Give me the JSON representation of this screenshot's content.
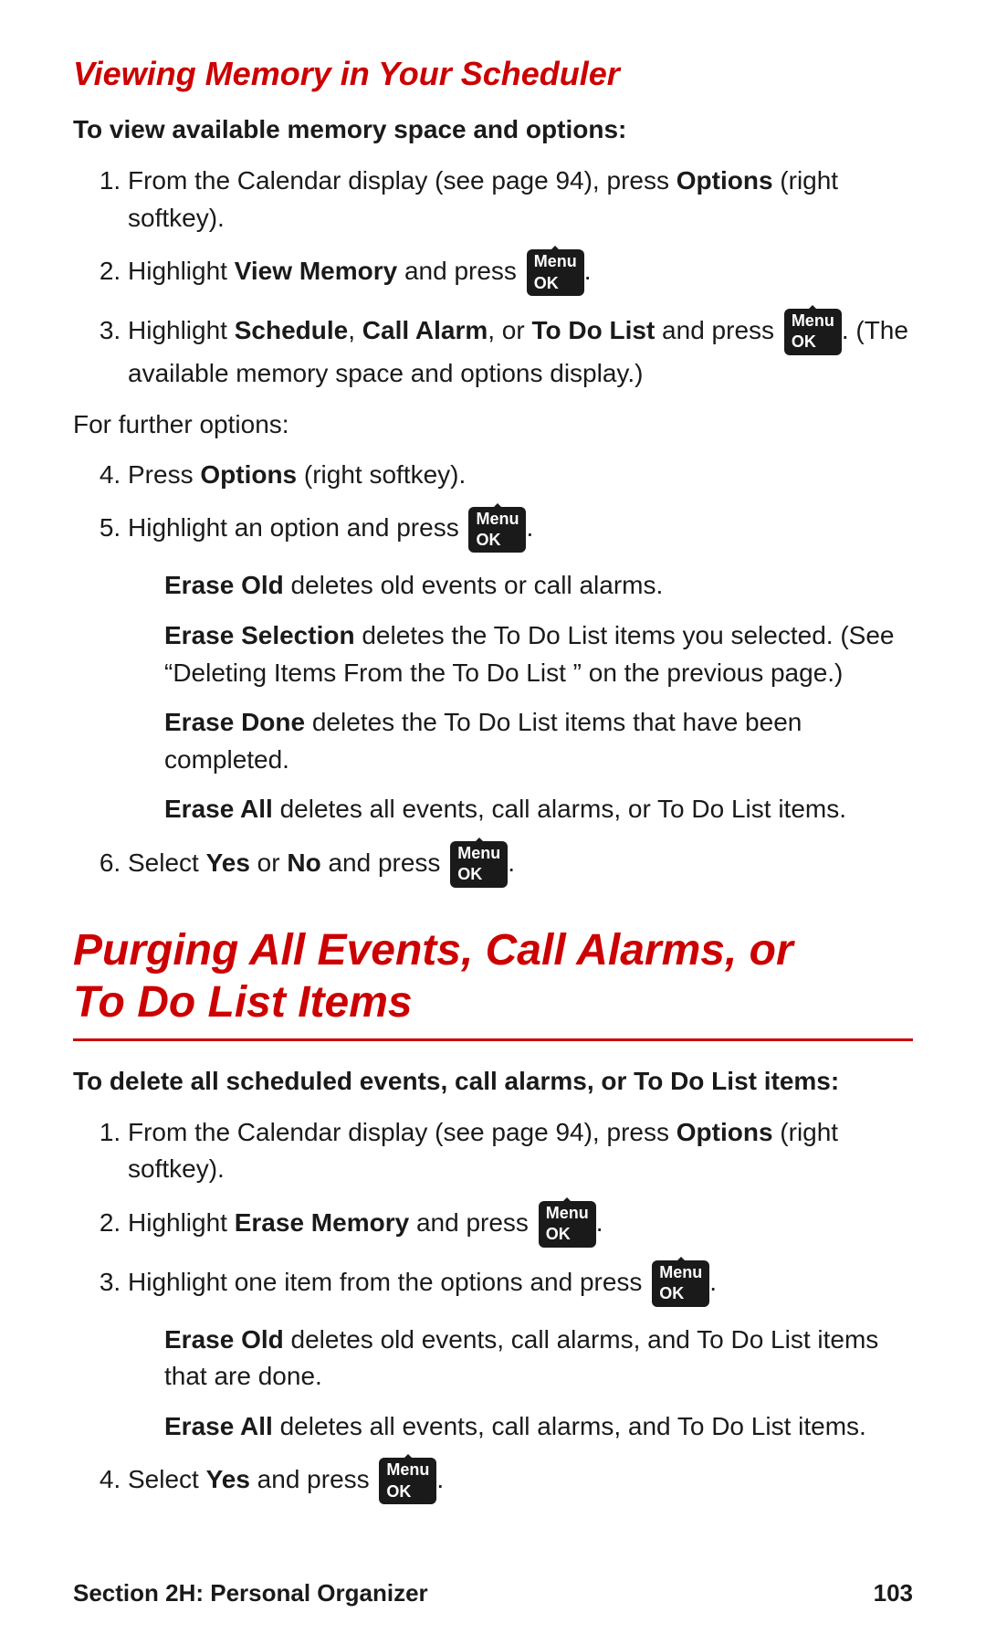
{
  "section1": {
    "title": "Viewing Memory in Your Scheduler",
    "subheading": "To view available memory space and options:",
    "steps": [
      {
        "num": 1,
        "text_before": "From the Calendar display (see page 94), press ",
        "bold": "Options",
        "text_after": " (right softkey)."
      },
      {
        "num": 2,
        "text_before": "Highlight ",
        "bold": "View Memory",
        "text_after": " and press",
        "has_icon": true
      },
      {
        "num": 3,
        "text_before": "Highlight ",
        "bold1": "Schedule",
        "sep1": ", ",
        "bold2": "Call Alarm",
        "sep2": ", or ",
        "bold3": "To Do List",
        "text_after": " and press",
        "has_icon": true,
        "extra": ". (The available memory space and options display.)"
      }
    ],
    "for_further": "For further options:",
    "steps2": [
      {
        "num": 4,
        "text": "Press ",
        "bold": "Options",
        "text_after": " (right softkey)."
      },
      {
        "num": 5,
        "text": "Highlight an option and press",
        "has_icon": true
      }
    ],
    "options": [
      {
        "bold": "Erase Old",
        "text": " deletes old events or call alarms."
      },
      {
        "bold": "Erase Selection",
        "text": " deletes the To Do List items you selected. (See “Deleting Items From the To Do List ” on the previous page.)"
      },
      {
        "bold": "Erase Done",
        "text": " deletes the To Do List items that have been completed."
      },
      {
        "bold": "Erase All",
        "text": " deletes all events, call alarms, or To Do List items."
      }
    ],
    "step6": {
      "num": 6,
      "text_before": "Select ",
      "bold1": "Yes",
      "sep": " or ",
      "bold2": "No",
      "text_after": " and press",
      "has_icon": true
    }
  },
  "section2": {
    "title_line1": "Purging All Events, Call Alarms, or",
    "title_line2": "To Do List Items",
    "subheading": "To delete all scheduled events, call alarms, or To Do List items:",
    "steps": [
      {
        "num": 1,
        "text_before": "From the Calendar display (see page 94), press ",
        "bold": "Options",
        "text_after": " (right softkey)."
      },
      {
        "num": 2,
        "text_before": "Highlight ",
        "bold": "Erase Memory",
        "text_after": " and press",
        "has_icon": true
      },
      {
        "num": 3,
        "text_before": "Highlight one item from the options and press",
        "has_icon": true
      }
    ],
    "options": [
      {
        "bold": "Erase Old",
        "text": " deletes old events, call alarms, and To Do List items that are done."
      },
      {
        "bold": "Erase All",
        "text": " deletes all events, call alarms, and To Do List items."
      }
    ],
    "step4": {
      "num": 4,
      "text_before": "Select ",
      "bold": "Yes",
      "text_after": " and press",
      "has_icon": true
    }
  },
  "footer": {
    "section_label": "Section 2H: Personal Organizer",
    "page_number": "103"
  },
  "icons": {
    "menu_ok_label": "Menu\nOK"
  }
}
